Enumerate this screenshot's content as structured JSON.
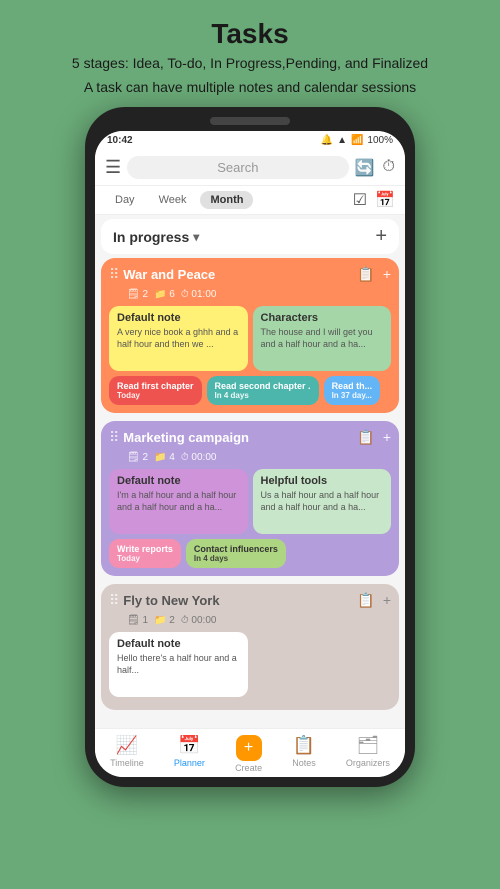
{
  "header": {
    "title": "Tasks",
    "subtitle1": "5 stages: Idea, To-do, In Progress,Pending, and Finalized",
    "subtitle2": "A task can have multiple notes and calendar sessions"
  },
  "status_bar": {
    "time": "10:42",
    "battery": "100%"
  },
  "search": {
    "placeholder": "Search"
  },
  "tabs": {
    "items": [
      "Day",
      "Week",
      "Month"
    ],
    "active": "Month"
  },
  "section": {
    "title": "In progress",
    "add_label": "+"
  },
  "tasks": [
    {
      "name": "War and Peace",
      "color": "orange",
      "meta": {
        "notes": "2",
        "sessions": "6",
        "time": "01:00"
      },
      "notes": [
        {
          "id": "default-note-1",
          "color": "yellow",
          "title": "Default note",
          "text": "A very nice book a ghhh and a half hour and then we ..."
        },
        {
          "id": "characters-note",
          "color": "green",
          "title": "Characters",
          "text": "The house and I will get you and a half hour and a ha..."
        }
      ],
      "sessions": [
        {
          "id": "session-read-first",
          "color": "red",
          "title": "Read first chapter",
          "sub": "Today"
        },
        {
          "id": "session-read-second",
          "color": "teal",
          "title": "Read second chapter",
          "sub": "In 4 days"
        },
        {
          "id": "session-read-third",
          "color": "blue",
          "title": "Read th...",
          "sub": "In 37 day..."
        }
      ]
    },
    {
      "name": "Marketing campaign",
      "color": "purple",
      "meta": {
        "notes": "2",
        "sessions": "4",
        "time": "00:00"
      },
      "notes": [
        {
          "id": "default-note-2",
          "color": "light-purple",
          "title": "Default note",
          "text": "I'm a half hour and a half hour and a half hour and a ha..."
        },
        {
          "id": "helpful-tools-note",
          "color": "light-green",
          "title": "Helpful tools",
          "text": "Us a half hour and a half hour and a half hour and a ha..."
        }
      ],
      "sessions": [
        {
          "id": "session-write-reports",
          "color": "pink",
          "title": "Write reports",
          "sub": "Today"
        },
        {
          "id": "session-contact-influencers",
          "color": "lime",
          "title": "Contact influencers",
          "sub": "In 4 days"
        }
      ]
    },
    {
      "name": "Fly to New York",
      "color": "beige",
      "meta": {
        "notes": "1",
        "sessions": "2",
        "time": "00:00"
      },
      "notes": [
        {
          "id": "default-note-3",
          "color": "default",
          "title": "Default note",
          "text": "Hello there's a half hour and a half..."
        }
      ],
      "sessions": []
    }
  ],
  "bottom_nav": {
    "items": [
      {
        "id": "timeline",
        "label": "Timeline",
        "icon": "📈"
      },
      {
        "id": "planner",
        "label": "Planner",
        "icon": "📅",
        "active": true
      },
      {
        "id": "create",
        "label": "Create",
        "icon": "+"
      },
      {
        "id": "notes",
        "label": "Notes",
        "icon": "📋"
      },
      {
        "id": "organizers",
        "label": "Organizers",
        "icon": "🗂"
      }
    ]
  }
}
